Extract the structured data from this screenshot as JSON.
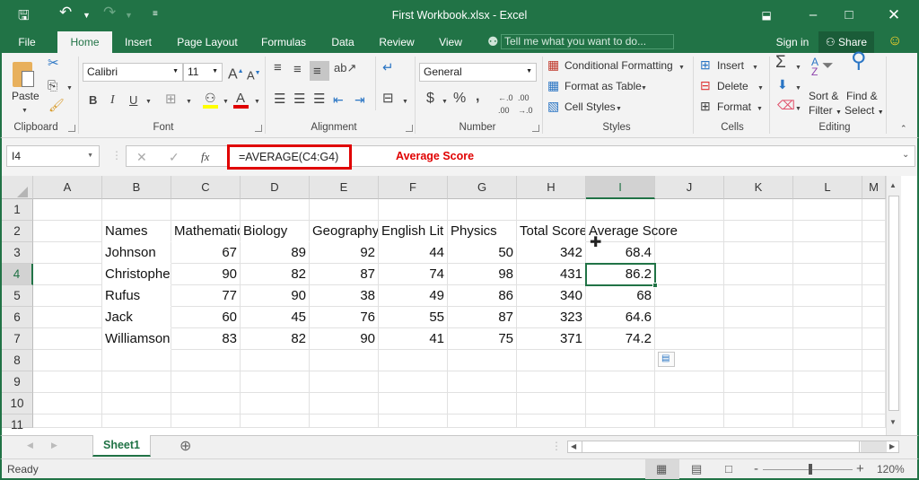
{
  "window": {
    "title": "First Workbook.xlsx - Excel",
    "qat": {
      "save_icon": "save-icon",
      "undo_icon": "undo-icon",
      "redo_icon": "redo-icon",
      "customize_icon": "customize-qat-icon"
    }
  },
  "tabs": [
    {
      "label": "File"
    },
    {
      "label": "Home",
      "active": true
    },
    {
      "label": "Insert"
    },
    {
      "label": "Page Layout"
    },
    {
      "label": "Formulas"
    },
    {
      "label": "Data"
    },
    {
      "label": "Review"
    },
    {
      "label": "View"
    }
  ],
  "tell_me": {
    "placeholder": "Tell me what you want to do..."
  },
  "account": {
    "sign_in": "Sign in",
    "share": "Share"
  },
  "ribbon": {
    "clipboard": {
      "label": "Clipboard",
      "paste": "Paste"
    },
    "font": {
      "label": "Font",
      "name": "Calibri",
      "size": "11",
      "bold": "B",
      "italic": "I",
      "underline": "U"
    },
    "alignment": {
      "label": "Alignment"
    },
    "number": {
      "label": "Number",
      "format": "General",
      "currency": "$",
      "percent": "%",
      "comma": ","
    },
    "styles": {
      "label": "Styles",
      "conditional": "Conditional Formatting",
      "format_table": "Format as Table",
      "cell_styles": "Cell Styles"
    },
    "cells": {
      "label": "Cells",
      "insert": "Insert",
      "delete": "Delete",
      "format": "Format"
    },
    "editing": {
      "label": "Editing",
      "sort": "Sort &",
      "sort2": "Filter",
      "find": "Find &",
      "find2": "Select"
    }
  },
  "formula_bar": {
    "name_box": "I4",
    "fx": "fx",
    "formula": "=AVERAGE(C4:G4)",
    "annotation": "Average Score",
    "annotation_color": "#e00000"
  },
  "sheet": {
    "columns": [
      "A",
      "B",
      "C",
      "D",
      "E",
      "F",
      "G",
      "H",
      "I",
      "J",
      "K",
      "L",
      "M"
    ],
    "rows": [
      "1",
      "2",
      "3",
      "4",
      "5",
      "6",
      "7",
      "8",
      "9",
      "10",
      "11"
    ],
    "selected_cell": "I4",
    "headers": [
      "Names",
      "Mathematics",
      "Biology",
      "Geography",
      "English Lit",
      "Physics",
      "Total Score",
      "Average Score"
    ],
    "data": [
      {
        "name": "Johnson",
        "math": "67",
        "bio": "89",
        "geo": "92",
        "eng": "44",
        "phy": "50",
        "total": "342",
        "avg": "68.4"
      },
      {
        "name": "Christopher",
        "math": "90",
        "bio": "82",
        "geo": "87",
        "eng": "74",
        "phy": "98",
        "total": "431",
        "avg": "86.2"
      },
      {
        "name": "Rufus",
        "math": "77",
        "bio": "90",
        "geo": "38",
        "eng": "49",
        "phy": "86",
        "total": "340",
        "avg": "68"
      },
      {
        "name": "Jack",
        "math": "60",
        "bio": "45",
        "geo": "76",
        "eng": "55",
        "phy": "87",
        "total": "323",
        "avg": "64.6"
      },
      {
        "name": "Williamson",
        "math": "83",
        "bio": "82",
        "geo": "90",
        "eng": "41",
        "phy": "75",
        "total": "371",
        "avg": "74.2"
      }
    ]
  },
  "sheet_tabs": [
    {
      "label": "Sheet1",
      "active": true
    }
  ],
  "status": {
    "text": "Ready",
    "zoom": "120%",
    "zoom_minus": "-",
    "zoom_plus": "+"
  },
  "colors": {
    "accent": "#217346",
    "annotation": "#e00000"
  }
}
